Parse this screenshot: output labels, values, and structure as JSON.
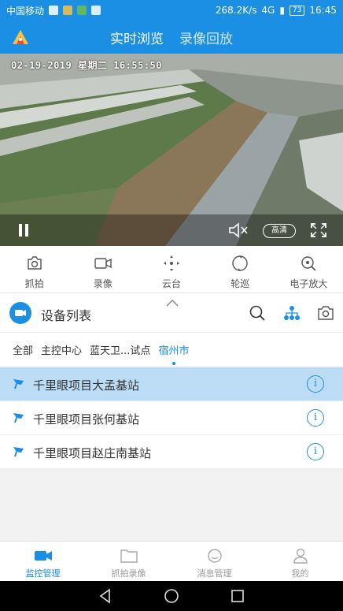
{
  "status_bar": {
    "carrier": "中国移动",
    "network_speed": "268.2K/s",
    "network_type": "4G",
    "battery": "73",
    "time": "16:45"
  },
  "app_bar": {
    "tabs": [
      {
        "label": "实时浏览",
        "active": true
      },
      {
        "label": "录像回放",
        "active": false
      }
    ]
  },
  "video": {
    "timestamp": "02-19-2019 星期二 16:55:50",
    "quality_label": "高清"
  },
  "toolbar": {
    "items": [
      {
        "label": "抓拍",
        "icon": "camera-icon"
      },
      {
        "label": "录像",
        "icon": "video-record-icon"
      },
      {
        "label": "云台",
        "icon": "ptz-icon"
      },
      {
        "label": "轮巡",
        "icon": "patrol-icon"
      },
      {
        "label": "电子放大",
        "icon": "zoom-icon"
      }
    ]
  },
  "device_list": {
    "title": "设备列表",
    "breadcrumbs": [
      {
        "label": "全部",
        "active": false
      },
      {
        "label": "主控中心",
        "active": false
      },
      {
        "label": "蓝天卫...试点",
        "active": false
      },
      {
        "label": "宿州市",
        "active": true
      }
    ],
    "items": [
      {
        "name": "千里眼项目大孟基站",
        "selected": true
      },
      {
        "name": "千里眼项目张何基站",
        "selected": false
      },
      {
        "name": "千里眼项目赵庄南基站",
        "selected": false
      }
    ]
  },
  "bottom_nav": {
    "items": [
      {
        "label": "监控管理",
        "active": true
      },
      {
        "label": "抓拍录像",
        "active": false
      },
      {
        "label": "消息管理",
        "active": false
      },
      {
        "label": "我的",
        "active": false
      }
    ]
  },
  "colors": {
    "primary": "#1b8fe3",
    "selected_row": "#bcdcf5"
  }
}
